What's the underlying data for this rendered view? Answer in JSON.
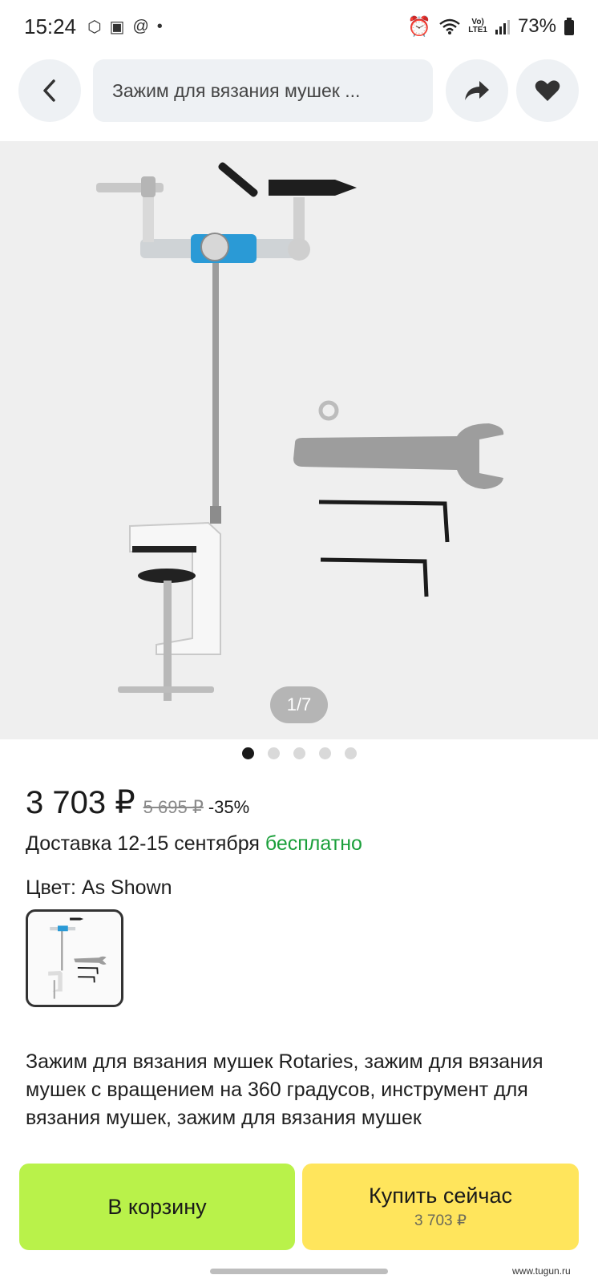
{
  "status_bar": {
    "time": "15:24",
    "battery": "73%",
    "network": "LTE1"
  },
  "top_bar": {
    "search_text": "Зажим для вязания мушек ..."
  },
  "gallery": {
    "counter": "1/7",
    "total_dots": 5,
    "active_dot": 0
  },
  "price": {
    "current": "3 703 ₽",
    "old": "5 695 ₽",
    "discount": "-35%"
  },
  "delivery": {
    "text": "Доставка 12-15 сентября",
    "free": "бесплатно"
  },
  "color": {
    "label": "Цвет: As Shown"
  },
  "description": "Зажим для вязания мушек Rotaries, зажим для вязания мушек с вращением на 360 градусов, инструмент для вязания мушек, зажим для вязания мушек",
  "buttons": {
    "cart": "В корзину",
    "buy": "Купить сейчас",
    "buy_price": "3 703 ₽"
  },
  "watermark": "www.tugun.ru",
  "colors": {
    "cart_button": "#b9f24a",
    "buy_button": "#ffe55c",
    "free_delivery": "#1a9f3a",
    "vise_accent": "#2a9ad6"
  }
}
